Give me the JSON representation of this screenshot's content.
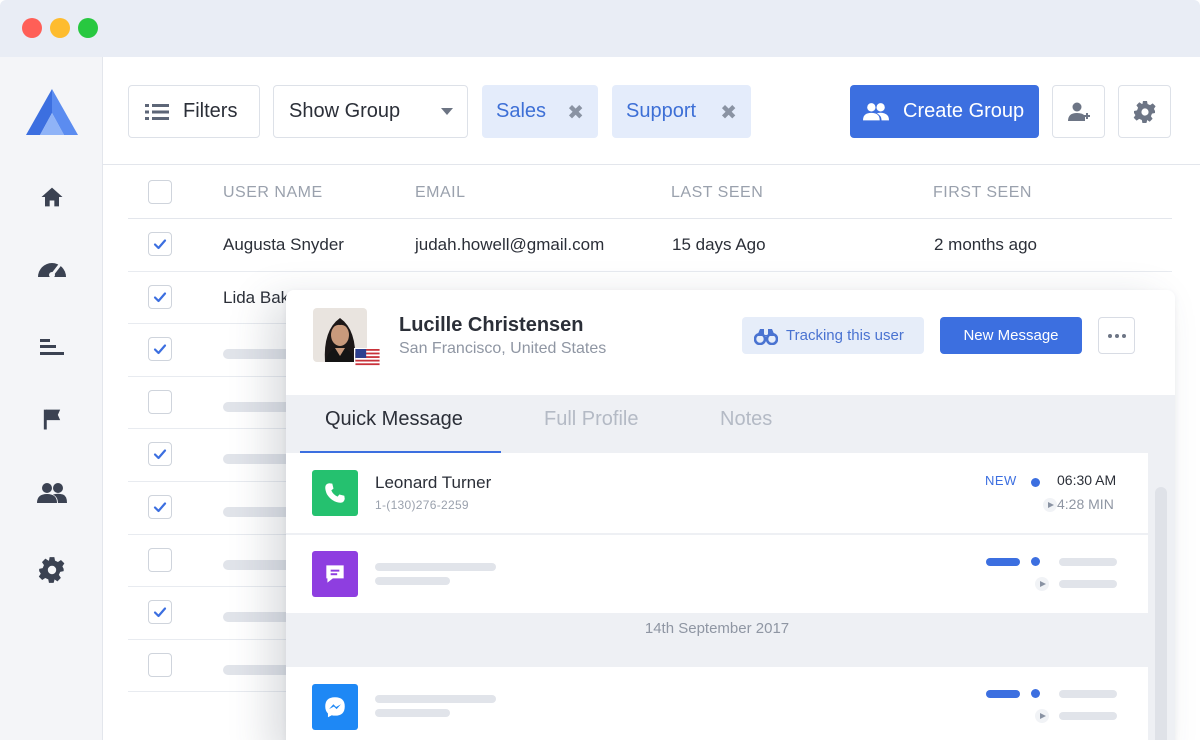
{
  "window": {
    "controls": [
      "close",
      "minimize",
      "maximize"
    ],
    "colors": {
      "close": "#ff5f57",
      "minimize": "#febc2e",
      "maximize": "#28c840"
    }
  },
  "sidebar": {
    "logo": "brand-logo",
    "items": [
      {
        "name": "home",
        "icon": "home-icon"
      },
      {
        "name": "dashboard",
        "icon": "speedometer-icon"
      },
      {
        "name": "reports",
        "icon": "bar-list-icon"
      },
      {
        "name": "flags",
        "icon": "flag-icon"
      },
      {
        "name": "users",
        "icon": "users-icon"
      },
      {
        "name": "settings",
        "icon": "gear-icon"
      }
    ]
  },
  "toolbar": {
    "filters_label": "Filters",
    "group_select_value": "Show Group",
    "chips": [
      {
        "label": "Sales",
        "remove": "✖"
      },
      {
        "label": "Support",
        "remove": "✖"
      }
    ],
    "create_group_label": "Create Group",
    "accent_color": "#3c6fe0"
  },
  "table": {
    "columns": [
      "USER NAME",
      "EMAIL",
      "LAST SEEN",
      "FIRST SEEN"
    ],
    "rows": [
      {
        "checked": true,
        "user_name": "Augusta Snyder",
        "email": "judah.howell@gmail.com",
        "last_seen": "15 days Ago",
        "first_seen": "2 months ago"
      },
      {
        "checked": true,
        "user_name": "Lida Bak"
      },
      {
        "checked": true
      },
      {
        "checked": false
      },
      {
        "checked": true
      },
      {
        "checked": true
      },
      {
        "checked": false
      },
      {
        "checked": true
      },
      {
        "checked": false
      }
    ]
  },
  "profile_card": {
    "name": "Lucille Christensen",
    "location": "San Francisco, United States",
    "tracking_label": "Tracking this user",
    "new_message_label": "New Message",
    "tabs": [
      {
        "label": "Quick Message",
        "active": true
      },
      {
        "label": "Full Profile",
        "active": false
      },
      {
        "label": "Notes",
        "active": false
      }
    ],
    "messages": [
      {
        "channel": "phone-icon",
        "color": "#25c16f",
        "name": "Leonard Turner",
        "phone": "1-(130)276-2259",
        "status": "NEW",
        "time": "06:30 AM",
        "duration": "4:28 MIN"
      },
      {
        "channel": "chat-icon",
        "color": "#8e3ee0"
      }
    ],
    "date_divider": "14th September 2017",
    "messages_after": [
      {
        "channel": "messenger-icon",
        "color": "#1e88f5"
      }
    ]
  }
}
